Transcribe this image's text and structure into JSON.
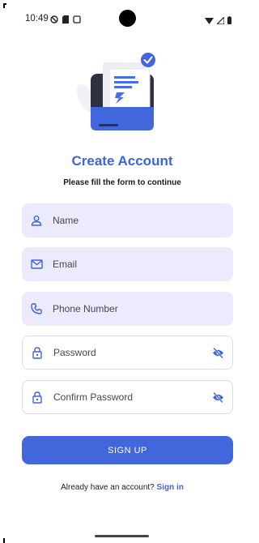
{
  "status_bar": {
    "time": "10:49",
    "left_icons": [
      "do-not-disturb-icon",
      "sd-card-icon",
      "screen-record-icon"
    ],
    "right_icons": [
      "wifi-icon",
      "signal-icon",
      "battery-icon"
    ]
  },
  "hero": {
    "icon": "document-folder-check-illustration"
  },
  "title": "Create Account",
  "subtitle": "Please fill the form to continue",
  "form": {
    "name": {
      "placeholder": "Name",
      "icon": "person-icon"
    },
    "email": {
      "placeholder": "Email",
      "icon": "mail-icon"
    },
    "phone": {
      "placeholder": "Phone Number",
      "icon": "phone-icon"
    },
    "password": {
      "placeholder": "Password",
      "icon": "lock-icon",
      "toggle_icon": "eye-off-icon"
    },
    "confirm_password": {
      "placeholder": "Confirm Password",
      "icon": "lock-icon",
      "toggle_icon": "eye-off-icon"
    }
  },
  "signup_label": "SIGN UP",
  "signin_prompt": "Already have an account? ",
  "signin_link": "Sign in",
  "colors": {
    "accent": "#3d63e0",
    "button": "#4266dc",
    "field_fill": "#ecebfd",
    "hero_dark": "#2f3140"
  }
}
